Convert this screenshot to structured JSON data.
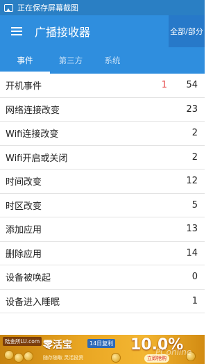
{
  "status_bar": {
    "notification": "正在保存屏幕截图"
  },
  "app_bar": {
    "title": "广播接收器",
    "filter_label": "全部/部分"
  },
  "tabs": [
    {
      "label": "事件",
      "active": true
    },
    {
      "label": "第三方",
      "active": false
    },
    {
      "label": "系统",
      "active": false
    }
  ],
  "events": [
    {
      "name": "开机事件",
      "badge": "1",
      "count": "54"
    },
    {
      "name": "网络连接改变",
      "badge": "",
      "count": "23"
    },
    {
      "name": "Wifi连接改变",
      "badge": "",
      "count": "2"
    },
    {
      "name": "Wifi开启或关闭",
      "badge": "",
      "count": "2"
    },
    {
      "name": "时间改变",
      "badge": "",
      "count": "12"
    },
    {
      "name": "时区改变",
      "badge": "",
      "count": "5"
    },
    {
      "name": "添加应用",
      "badge": "",
      "count": "13"
    },
    {
      "name": "删除应用",
      "badge": "",
      "count": "14"
    },
    {
      "name": "设备被唤起",
      "badge": "",
      "count": "0"
    },
    {
      "name": "设备进入睡眠",
      "badge": "",
      "count": "1"
    }
  ],
  "ad": {
    "brand": "陆金所LU.com",
    "product": "零活宝",
    "tag": "14日复利",
    "subtitle": "随存随取 灵活投资",
    "rate": "10.0%",
    "button": "立即抢购",
    "watermark": "PConline"
  },
  "colors": {
    "accent": "#2f8ede",
    "status_bar": "#2a7fc4",
    "badge": "#e54b4b"
  }
}
